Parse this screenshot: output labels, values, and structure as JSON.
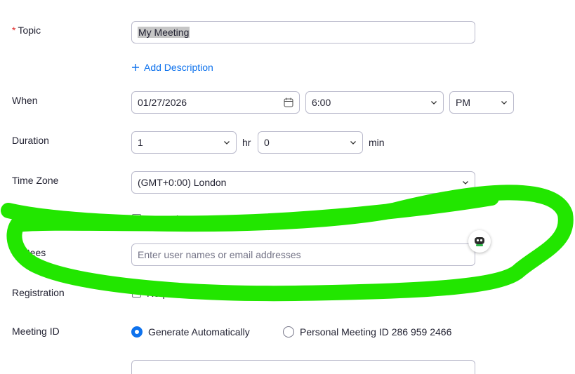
{
  "labels": {
    "topic": "Topic",
    "required_mark": "*",
    "when": "When",
    "duration": "Duration",
    "time_zone": "Time Zone",
    "invitees": "Invitees",
    "registration": "Registration",
    "meeting_id": "Meeting ID"
  },
  "topic": {
    "value": "My Meeting"
  },
  "add_description": {
    "label": "Add Description",
    "icon": "plus-icon"
  },
  "when": {
    "date": "01/27/2026",
    "date_icon": "calendar-icon",
    "time": "6:00",
    "ampm": "PM"
  },
  "duration": {
    "hours": "1",
    "hours_unit": "hr",
    "minutes": "0",
    "minutes_unit": "min"
  },
  "time_zone": {
    "value": "(GMT+0:00) London"
  },
  "recurring": {
    "label": "Recurring meeting",
    "checked": false
  },
  "invitees": {
    "placeholder": "Enter user names or email addresses"
  },
  "registration": {
    "label": "Required",
    "checked": false
  },
  "meeting_id": {
    "option_auto": "Generate Automatically",
    "option_personal": "Personal Meeting ID 286 959 2466",
    "selected": "Generate Automatically"
  },
  "colors": {
    "accent": "#0e72ed",
    "annotation": "#22e600",
    "required": "#e02828"
  }
}
